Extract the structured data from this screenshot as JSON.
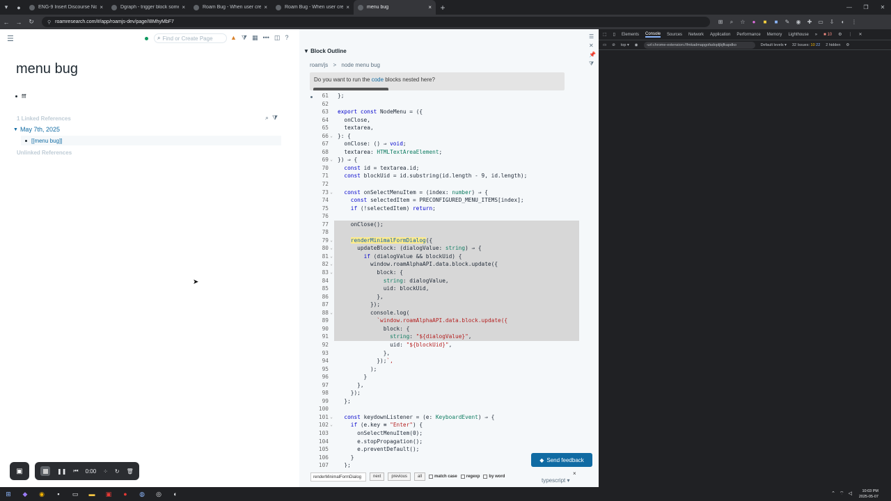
{
  "browser": {
    "tabs": [
      {
        "title": "ENG-9 Insert Discourse Node",
        "active": false
      },
      {
        "title": "Dgraph - trigger block someth",
        "active": false
      },
      {
        "title": "Roam Bug - When user create",
        "active": false
      },
      {
        "title": "Roam Bug - When user create",
        "active": false
      },
      {
        "title": "menu bug",
        "active": true
      }
    ],
    "url": "roamresearch.com/#/app/roamjs-dev/page/I8MhyMbF7"
  },
  "left": {
    "search_placeholder": "Find or Create Page",
    "page_title": "menu bug",
    "block_text": "fff",
    "linked_refs_label": "1 Linked References",
    "ref_date": "May 7th, 2025",
    "ref_block": "[[menu bug]]",
    "unlinked_refs_label": "Unlinked References"
  },
  "recorder": {
    "time": "0:00"
  },
  "right": {
    "title": "Block Outline",
    "breadcrumb_root": "roam/js",
    "breadcrumb_sep": ">",
    "breadcrumb_page": "node menu bug",
    "run_prompt_pre": "Do you want to run the ",
    "run_prompt_code": "code",
    "run_prompt_post": " blocks nested here?",
    "find_input": "renderMinimalFormDialog",
    "find_next": "next",
    "find_prev": "previous",
    "find_all": "all",
    "match_case": "match case",
    "regexp": "regexp",
    "by_word": "by word",
    "language": "typescript",
    "feedback": "Send feedback"
  },
  "devtools": {
    "tabs": [
      "Elements",
      "Console",
      "Sources",
      "Network",
      "Application",
      "Performance",
      "Memory",
      "Lighthouse"
    ],
    "active_tab": "Console",
    "issues_badge": "10",
    "context": "top",
    "filter": "-url:chrome-extension://fmkadmapgofadopljbjfkapdko",
    "levels": "Default levels",
    "issues_count": "32 Issues:",
    "issues_a": "10",
    "issues_b": "22",
    "hidden": "2 hidden"
  },
  "taskbar": {
    "time": "10:03 PM",
    "date": "2025-05-07"
  },
  "code": [
    {
      "n": "61",
      "fold": false,
      "hl": false,
      "t": "};"
    },
    {
      "n": "62",
      "fold": false,
      "hl": false,
      "t": ""
    },
    {
      "n": "63",
      "fold": false,
      "hl": false,
      "t": "export const NodeMenu = ({"
    },
    {
      "n": "64",
      "fold": false,
      "hl": false,
      "t": "  onClose,"
    },
    {
      "n": "65",
      "fold": false,
      "hl": false,
      "t": "  textarea,"
    },
    {
      "n": "66",
      "fold": true,
      "hl": false,
      "t": "}: {"
    },
    {
      "n": "67",
      "fold": false,
      "hl": false,
      "t": "  onClose: () ⇒ void;"
    },
    {
      "n": "68",
      "fold": false,
      "hl": false,
      "t": "  textarea: HTMLTextAreaElement;"
    },
    {
      "n": "69",
      "fold": true,
      "hl": false,
      "t": "}) ⇒ {"
    },
    {
      "n": "70",
      "fold": false,
      "hl": false,
      "t": "  const id = textarea.id;"
    },
    {
      "n": "71",
      "fold": false,
      "hl": false,
      "t": "  const blockUid = id.substring(id.length - 9, id.length);"
    },
    {
      "n": "72",
      "fold": false,
      "hl": false,
      "t": ""
    },
    {
      "n": "73",
      "fold": true,
      "hl": false,
      "t": "  const onSelectMenuItem = (index: number) ⇒ {"
    },
    {
      "n": "74",
      "fold": false,
      "hl": false,
      "t": "    const selectedItem = PRECONFIGURED_MENU_ITEMS[index];"
    },
    {
      "n": "75",
      "fold": false,
      "hl": false,
      "t": "    if (!selectedItem) return;"
    },
    {
      "n": "76",
      "fold": false,
      "hl": false,
      "t": ""
    },
    {
      "n": "77",
      "fold": false,
      "hl": true,
      "t": "    onClose();"
    },
    {
      "n": "78",
      "fold": false,
      "hl": true,
      "t": ""
    },
    {
      "n": "79",
      "fold": true,
      "hl": true,
      "t": "    renderMinimalFormDialog({"
    },
    {
      "n": "80",
      "fold": true,
      "hl": true,
      "t": "      updateBlock: (dialogValue: string) ⇒ {"
    },
    {
      "n": "81",
      "fold": true,
      "hl": true,
      "t": "        if (dialogValue && blockUid) {"
    },
    {
      "n": "82",
      "fold": true,
      "hl": true,
      "t": "          window.roamAlphaAPI.data.block.update({"
    },
    {
      "n": "83",
      "fold": true,
      "hl": true,
      "t": "            block: {"
    },
    {
      "n": "84",
      "fold": false,
      "hl": true,
      "t": "              string: dialogValue,"
    },
    {
      "n": "85",
      "fold": false,
      "hl": true,
      "t": "              uid: blockUid,"
    },
    {
      "n": "86",
      "fold": false,
      "hl": true,
      "t": "            },"
    },
    {
      "n": "87",
      "fold": false,
      "hl": true,
      "t": "          });"
    },
    {
      "n": "88",
      "fold": true,
      "hl": true,
      "t": "          console.log("
    },
    {
      "n": "89",
      "fold": false,
      "hl": true,
      "t": "            `window.roamAlphaAPI.data.block.update({"
    },
    {
      "n": "90",
      "fold": false,
      "hl": true,
      "t": "              block: {"
    },
    {
      "n": "91",
      "fold": false,
      "hl": true,
      "t": "                string: \"${dialogValue}\","
    },
    {
      "n": "92",
      "fold": false,
      "hl": false,
      "t": "                uid: \"${blockUid}\","
    },
    {
      "n": "93",
      "fold": false,
      "hl": false,
      "t": "              },"
    },
    {
      "n": "94",
      "fold": false,
      "hl": false,
      "t": "            });`,"
    },
    {
      "n": "95",
      "fold": false,
      "hl": false,
      "t": "          );"
    },
    {
      "n": "96",
      "fold": false,
      "hl": false,
      "t": "        }"
    },
    {
      "n": "97",
      "fold": false,
      "hl": false,
      "t": "      },"
    },
    {
      "n": "98",
      "fold": false,
      "hl": false,
      "t": "    });"
    },
    {
      "n": "99",
      "fold": false,
      "hl": false,
      "t": "  };"
    },
    {
      "n": "100",
      "fold": false,
      "hl": false,
      "t": ""
    },
    {
      "n": "101",
      "fold": true,
      "hl": false,
      "t": "  const keydownListener = (e: KeyboardEvent) ⇒ {"
    },
    {
      "n": "102",
      "fold": true,
      "hl": false,
      "t": "    if (e.key ≡ \"Enter\") {"
    },
    {
      "n": "103",
      "fold": false,
      "hl": false,
      "t": "      onSelectMenuItem(0);"
    },
    {
      "n": "104",
      "fold": false,
      "hl": false,
      "t": "      e.stopPropagation();"
    },
    {
      "n": "105",
      "fold": false,
      "hl": false,
      "t": "      e.preventDefault();"
    },
    {
      "n": "106",
      "fold": false,
      "hl": false,
      "t": "    }"
    },
    {
      "n": "107",
      "fold": false,
      "hl": false,
      "t": "  };"
    }
  ]
}
